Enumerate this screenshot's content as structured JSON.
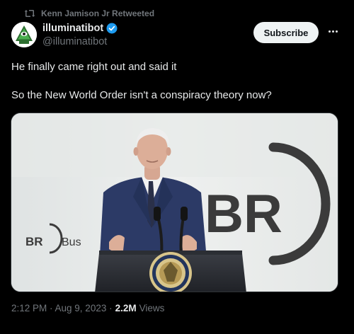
{
  "retweet": {
    "label": "Kenn Jamison Jr Retweeted"
  },
  "author": {
    "display_name": "illuminatibot",
    "handle": "@illuminatibot",
    "verified": true
  },
  "actions": {
    "subscribe_label": "Subscribe"
  },
  "tweet": {
    "lines": [
      "He finally came right out and said it",
      "So the New World Order isn't a conspiracy theory now?"
    ]
  },
  "media": {
    "type": "video-still",
    "logo_big": "BR",
    "logo_small": "BR",
    "logo_small_suffix": "Bus"
  },
  "meta": {
    "timestamp": "2:12 PM · Aug 9, 2023 · ",
    "views_count": "2.2M",
    "views_label": "Views"
  },
  "colors": {
    "background": "#000000",
    "text": "#e7e9ea",
    "muted": "#71767b",
    "verified": "#1d9bf0",
    "button_bg": "#eff3f4"
  },
  "icons": [
    "retweet-icon",
    "verified-icon",
    "more-icon"
  ]
}
